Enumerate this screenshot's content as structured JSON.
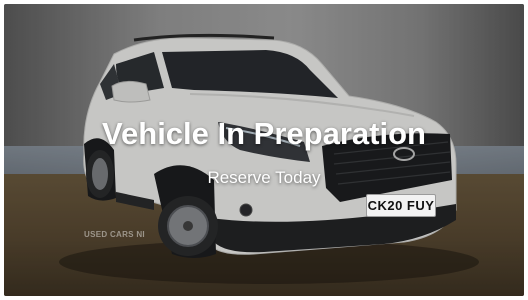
{
  "listing": {
    "headline": "Vehicle In Preparation",
    "subline": "Reserve Today",
    "plate": "CK20 FUY",
    "watermark": "USED CARS NI"
  },
  "colors": {
    "car_body": "#f2f2f0",
    "wall": "#9a9a9a",
    "floor": "#5a4a33",
    "text": "#ffffff"
  }
}
